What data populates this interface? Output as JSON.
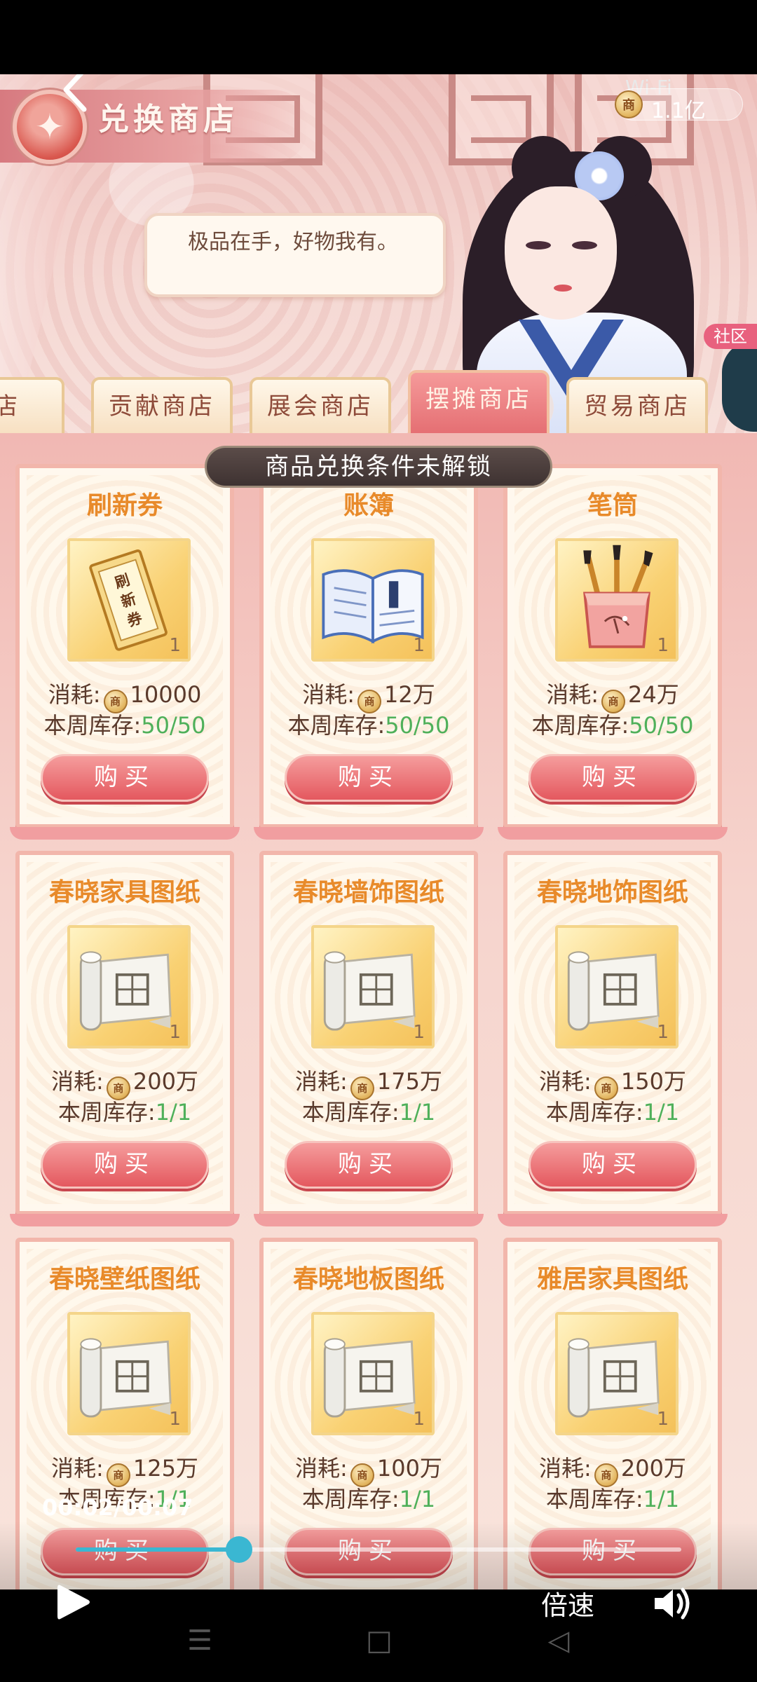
{
  "header": {
    "title": "兑换商店",
    "back_icon": "chevron-left-icon",
    "wifi_label": "Wi-Fi",
    "currency_icon_text": "商",
    "currency_value": "1.1亿",
    "side_label": "社区"
  },
  "speech": {
    "text": "极品在手，好物我有。"
  },
  "tabs": [
    {
      "label": "商店",
      "active": false
    },
    {
      "label": "贡献商店",
      "active": false
    },
    {
      "label": "展会商店",
      "active": false
    },
    {
      "label": "摆摊商店",
      "active": true
    },
    {
      "label": "贸易商店",
      "active": false
    }
  ],
  "banner": "商品兑换条件未解锁",
  "labels": {
    "cost": "消耗:",
    "stock": "本周库存:",
    "buy": "购买",
    "coin_text": "商"
  },
  "items": [
    {
      "name": "刷新券",
      "qty": "1",
      "cost": "10000",
      "stock": "50/50",
      "art": "ticket-icon"
    },
    {
      "name": "账簿",
      "qty": "1",
      "cost": "12万",
      "stock": "50/50",
      "art": "ledger-book-icon"
    },
    {
      "name": "笔筒",
      "qty": "1",
      "cost": "24万",
      "stock": "50/50",
      "art": "brush-pot-icon"
    },
    {
      "name": "春晓家具图纸",
      "qty": "1",
      "cost": "200万",
      "stock": "1/1",
      "art": "blueprint-scroll-icon"
    },
    {
      "name": "春晓墙饰图纸",
      "qty": "1",
      "cost": "175万",
      "stock": "1/1",
      "art": "blueprint-scroll-icon"
    },
    {
      "name": "春晓地饰图纸",
      "qty": "1",
      "cost": "150万",
      "stock": "1/1",
      "art": "blueprint-scroll-icon"
    },
    {
      "name": "春晓壁纸图纸",
      "qty": "1",
      "cost": "125万",
      "stock": "1/1",
      "art": "blueprint-scroll-icon"
    },
    {
      "name": "春晓地板图纸",
      "qty": "1",
      "cost": "100万",
      "stock": "1/1",
      "art": "blueprint-scroll-icon"
    },
    {
      "name": "雅居家具图纸",
      "qty": "1",
      "cost": "200万",
      "stock": "1/1",
      "art": "blueprint-scroll-icon"
    }
  ],
  "ticket_text": "刷新券",
  "video": {
    "time": "00:02/00:07",
    "progress": 0.27,
    "speed_label": "倍速",
    "play_icon": "play-icon",
    "volume_icon": "volume-icon"
  },
  "colors": {
    "accent_red": "#e4585f",
    "stock_green": "#4fb05a",
    "name_orange": "#e88a2a",
    "progress_blue": "#3ab7d2"
  }
}
